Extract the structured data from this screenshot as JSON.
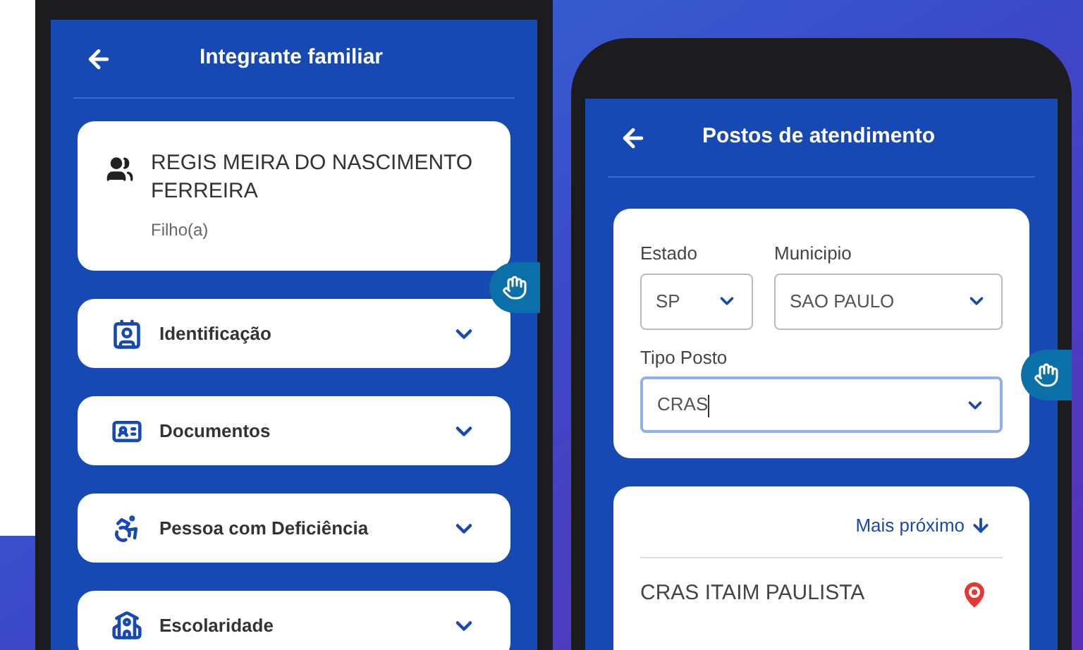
{
  "left_screen": {
    "title": "Integrante familiar",
    "member": {
      "name": "REGIS MEIRA DO NASCIMENTO FERREIRA",
      "relation": "Filho(a)"
    },
    "sections": [
      {
        "kind": "badge",
        "label": "Identificação",
        "expanded": false
      },
      {
        "kind": "card",
        "label": "Documentos",
        "expanded": false
      },
      {
        "kind": "wheelchair",
        "label": "Pessoa com Deficiência",
        "expanded": false
      },
      {
        "kind": "school",
        "label": "Escolaridade",
        "expanded": false
      }
    ]
  },
  "right_screen": {
    "title": "Postos de atendimento",
    "fields": [
      {
        "label": "Estado",
        "value": "SP",
        "focused": false
      },
      {
        "label": "Municipio",
        "value": "SAO PAULO",
        "focused": false
      },
      {
        "label": "Tipo Posto",
        "value": "CRAS",
        "focused": true
      }
    ],
    "sort_link": "Mais próximo",
    "results": [
      {
        "name": "CRAS ITAIM PAULISTA"
      }
    ]
  }
}
